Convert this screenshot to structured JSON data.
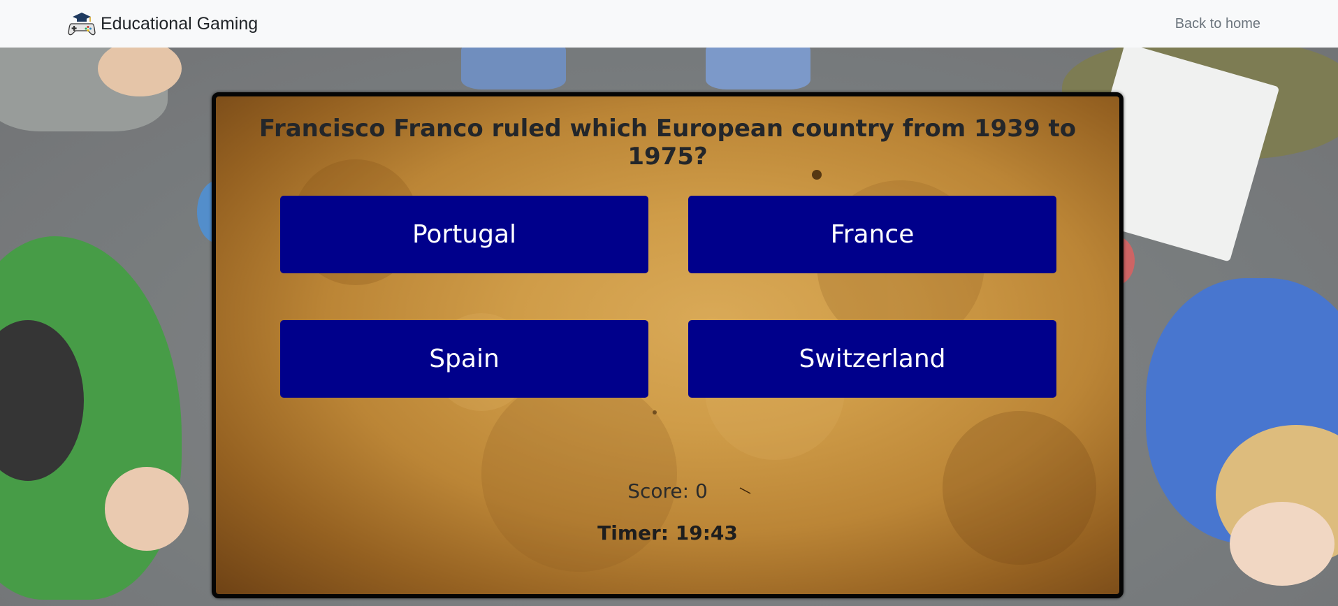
{
  "navbar": {
    "brand_icon": "gamepad-graduation-cap-icon",
    "brand_text": "Educational Gaming",
    "back_link": "Back to home"
  },
  "quiz": {
    "question": "Francisco Franco ruled which European country from 1939 to 1975?",
    "answers": [
      "Portugal",
      "France",
      "Spain",
      "Switzerland"
    ],
    "score": "Score: 0",
    "timer": "Timer: 19:43"
  },
  "colors": {
    "navbar_bg": "#f8f9fa",
    "answer_button_bg": "#00008b",
    "answer_button_text": "#ffffff",
    "card_border": "#050505",
    "question_text": "#23262a"
  }
}
